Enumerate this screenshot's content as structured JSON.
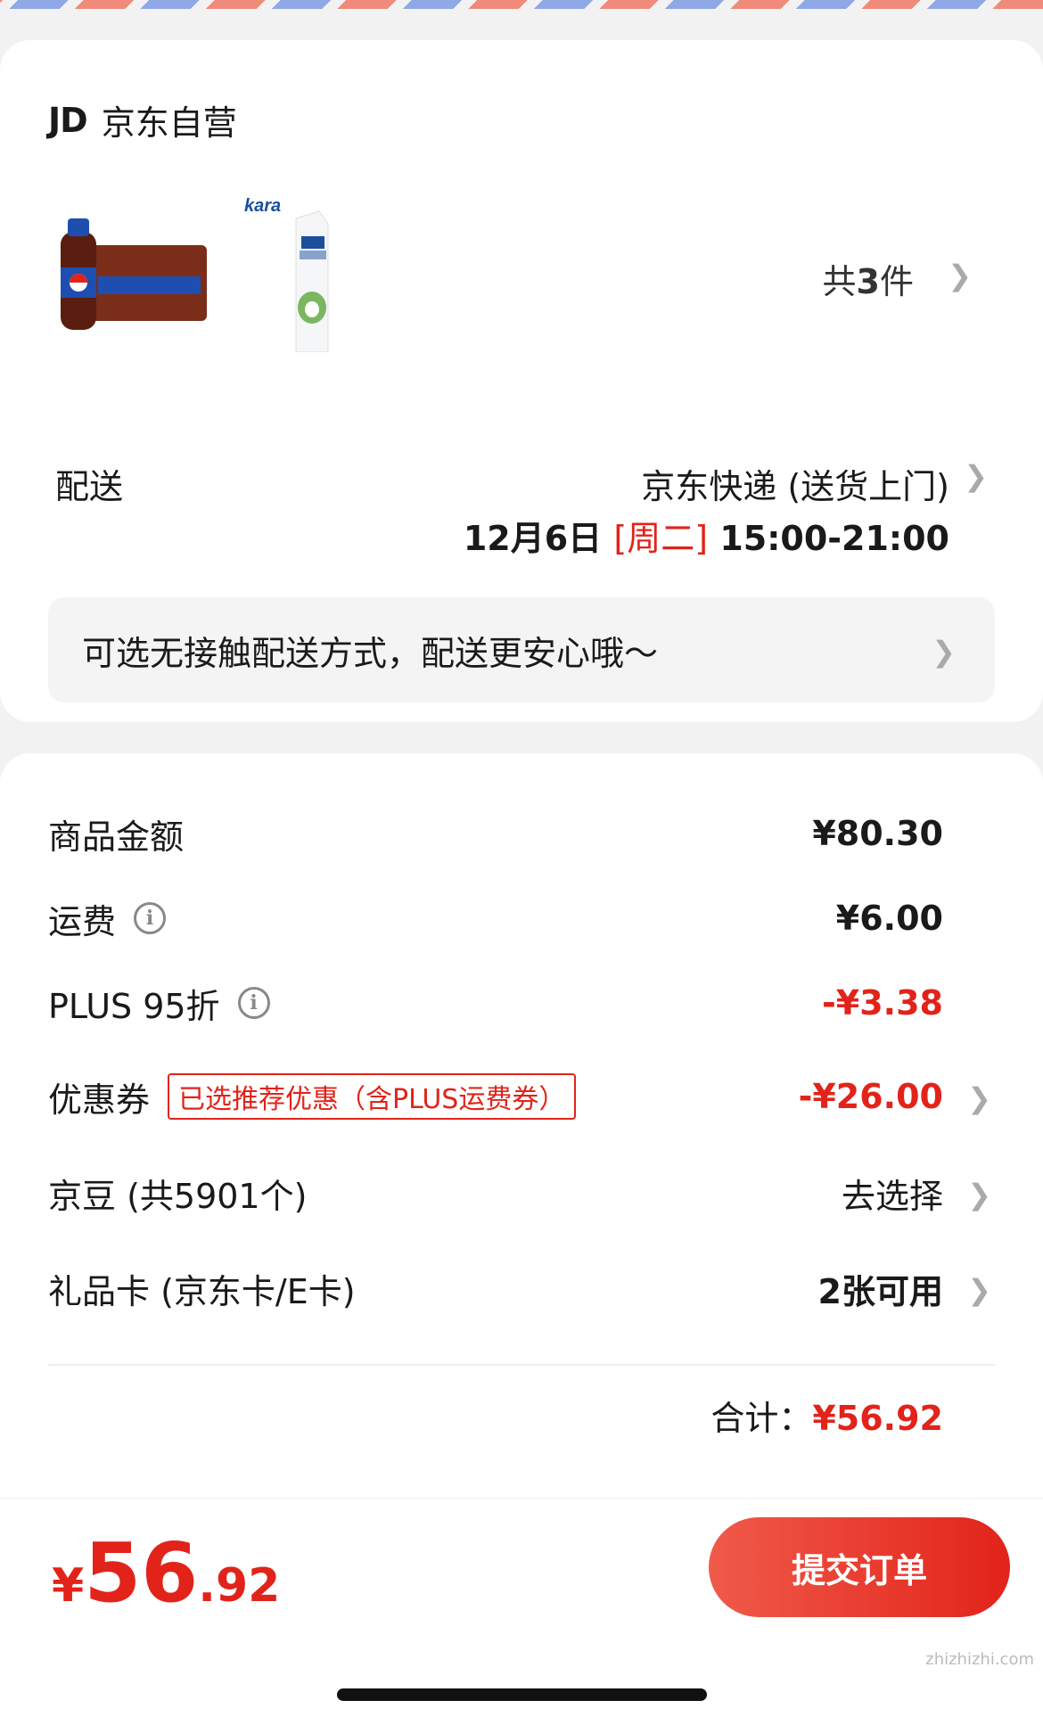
{
  "shop": {
    "logo": "JD",
    "name": "京东自营"
  },
  "items": {
    "count_prefix": "共",
    "count": "3",
    "count_suffix": "件"
  },
  "delivery": {
    "label": "配送",
    "method": "京东快递 (送货上门)",
    "date": "12月6日",
    "weekday": "[周二]",
    "time": "15:00-21:00"
  },
  "notice": "可选无接触配送方式，配送更安心哦～",
  "fees": {
    "goods_label": "商品金额",
    "goods_value": "¥80.30",
    "shipping_label": "运费",
    "shipping_value": "¥6.00",
    "plus_label": "PLUS 95折",
    "plus_value": "-¥3.38",
    "coupon_label": "优惠券",
    "coupon_tag": "已选推荐优惠（含PLUS运费券）",
    "coupon_value": "-¥26.00",
    "jingdou_label": "京豆 (共5901个)",
    "jingdou_value": "去选择",
    "giftcard_label": "礼品卡 (京东卡/E卡)",
    "giftcard_value": "2张可用"
  },
  "total": {
    "label": "合计：",
    "value": "¥56.92"
  },
  "footer": {
    "currency": "¥",
    "price_int": "56",
    "price_dec": ".92",
    "submit": "提交订单"
  },
  "watermark": "zhizhizhi.com",
  "colors": {
    "accent": "#e2231a"
  }
}
